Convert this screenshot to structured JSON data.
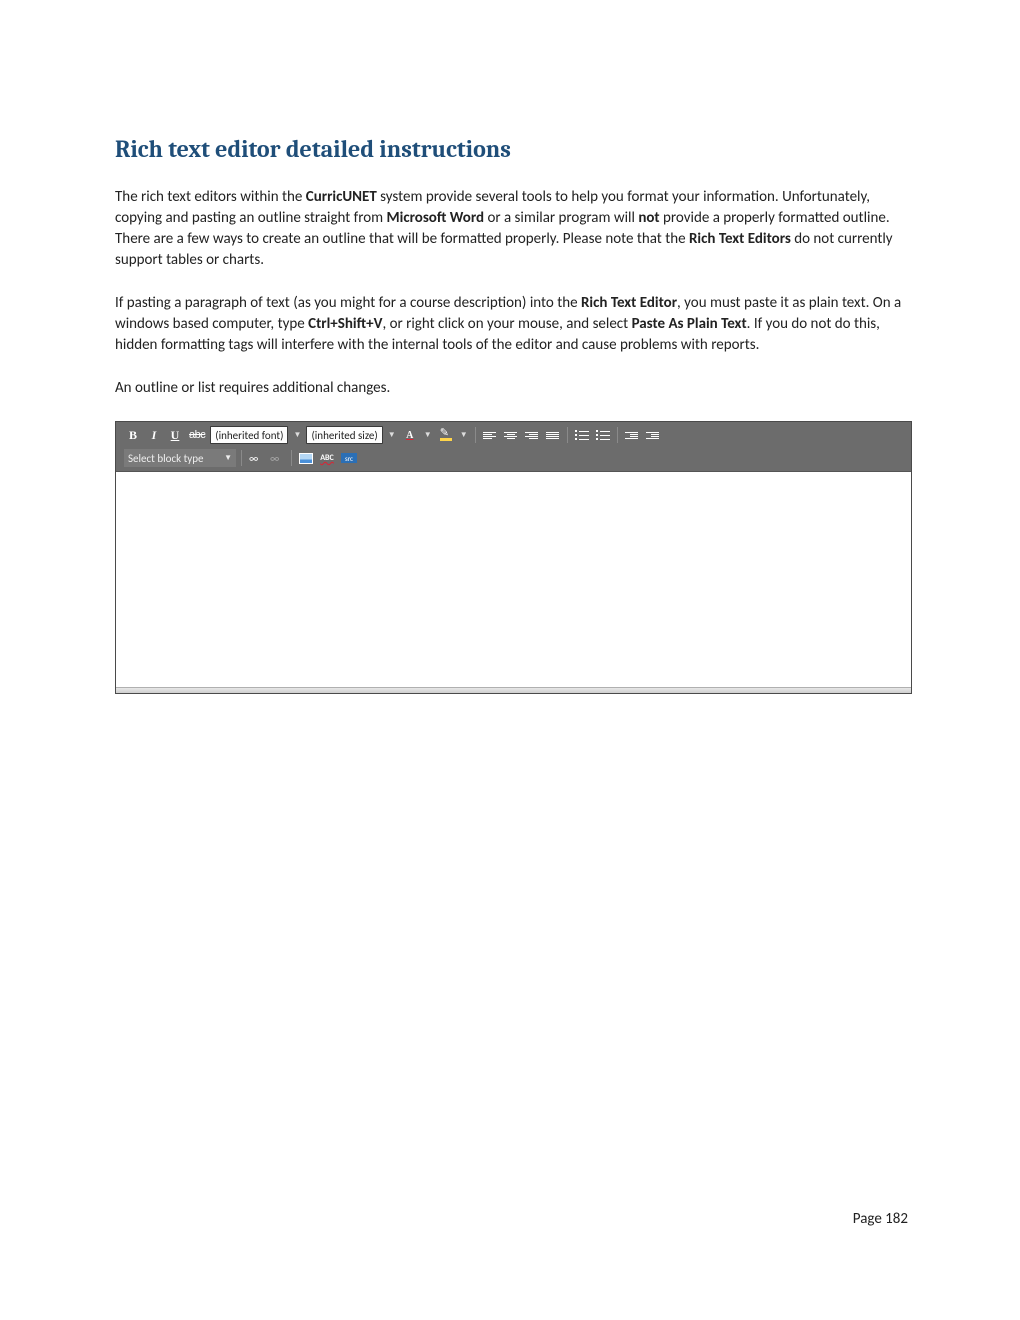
{
  "heading": "Rich text editor detailed instructions",
  "para1": {
    "seg1": "The rich text editors within the ",
    "b1": "CurricUNET",
    "seg2": " system provide several tools to help you format your information. Unfortunately, copying and pasting an outline straight from ",
    "b2": "Microsoft Word",
    "seg3": " or a similar program will ",
    "b3": "not",
    "seg4": " provide a properly formatted outline. There are a few ways to create an outline that will be formatted properly. Please note that the ",
    "b4": "Rich Text Editors",
    "seg5": " do not currently support tables or charts."
  },
  "para2": {
    "seg1": "If pasting a paragraph of text (as you might for a course description) into the ",
    "b1": "Rich Text Editor",
    "seg2": ", you must paste it as plain text. On a windows based computer, type ",
    "b2": "Ctrl+Shift+V",
    "seg3": ", or right click on your mouse, and select ",
    "b3": "Paste As Plain Text",
    "seg4": ". If you do not do this, hidden formatting tags will interfere with the internal tools of the editor and cause problems with reports."
  },
  "para3": "An outline or list requires additional changes.",
  "toolbar": {
    "bold": "B",
    "italic": "I",
    "underline": "U",
    "strike": "abc",
    "font": "(inherited font)",
    "size": "(inherited size)",
    "textcolor": "A",
    "blocktype": "Select block type",
    "spell": "ABC",
    "src": "src"
  },
  "footer": {
    "page_label": "Page 182"
  }
}
